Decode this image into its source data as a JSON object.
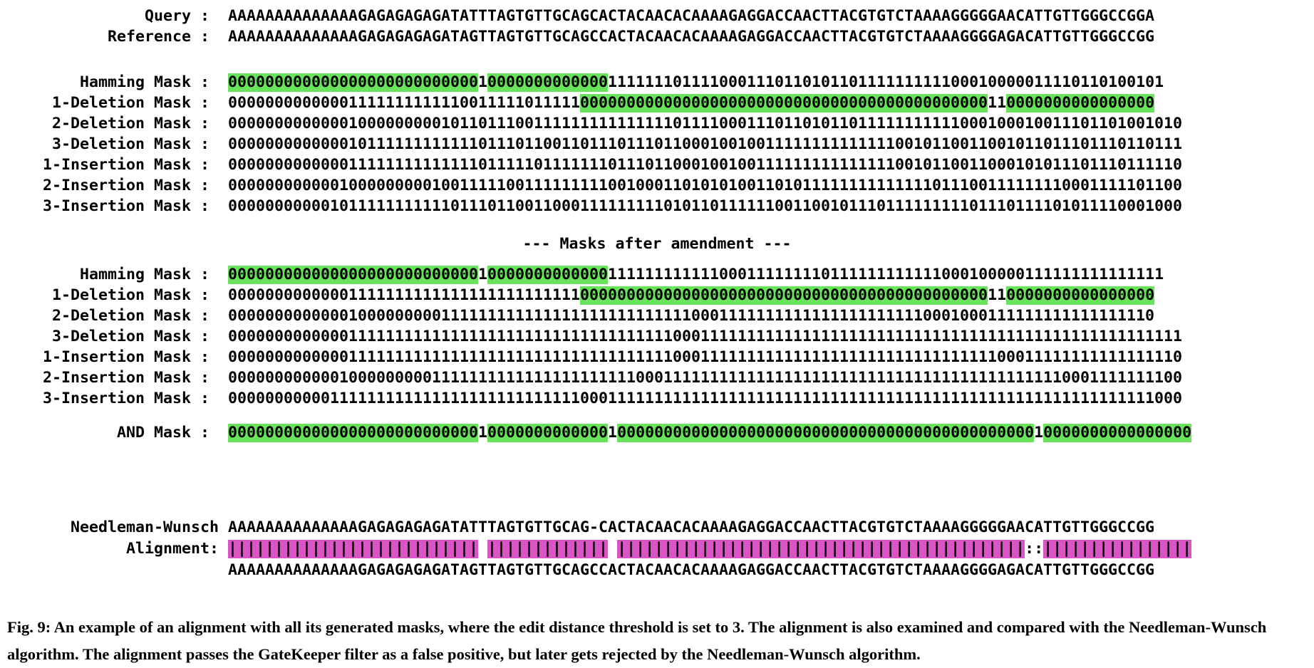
{
  "colors": {
    "match_highlight": "#6ae35c",
    "alignment_highlight": "#d955c4"
  },
  "sequences": [
    {
      "label": "Query",
      "separator": " : ",
      "segments": [
        {
          "text": "AAAAAAAAAAAAAAGAGAGAGAGATATTTAGTGTTGCAGCACTACAACACAAAAGAGGACCAACTTACGTGTCTAAAAGGGGGAACATTGTTGGGCCGGA",
          "hl": false
        }
      ]
    },
    {
      "label": "Reference",
      "separator": " : ",
      "segments": [
        {
          "text": "AAAAAAAAAAAAAAGAGAGAGAGATAGTTAGTGTTGCAGCCACTACAACACAAAAGAGGACCAACTTACGTGTCTAAAAGGGGAGACATTGTTGGGCCGG",
          "hl": false
        }
      ]
    }
  ],
  "masks_before": [
    {
      "label": "Hamming Mask",
      "separator": " : ",
      "segments": [
        {
          "text": "000000000000000000000000000",
          "hl": true
        },
        {
          "text": "1",
          "hl": false
        },
        {
          "text": "0000000000000",
          "hl": true
        },
        {
          "text": "111111101111000111011010110111111111100010000011110110100101",
          "hl": false
        }
      ]
    },
    {
      "label": "1-Deletion Mask",
      "separator": " : ",
      "segments": [
        {
          "text": "00000000000001111111111110011111011111",
          "hl": false
        },
        {
          "text": "00000000000000000000000000000000000000000000",
          "hl": true
        },
        {
          "text": "11",
          "hl": false
        },
        {
          "text": "0000000000000000",
          "hl": true
        }
      ]
    },
    {
      "label": "2-Deletion Mask",
      "separator": " : ",
      "segments": [
        {
          "text": "0000000000000100000000010110111001111111111111110111100011101101011011111111111000100010011101101001010",
          "hl": false
        }
      ]
    },
    {
      "label": "3-Deletion Mask",
      "separator": " : ",
      "segments": [
        {
          "text": "0000000000000101111111111110111011001101110111011000100100111111111111110010110011001011011101110110111",
          "hl": false
        }
      ]
    },
    {
      "label": "1-Insertion Mask",
      "separator": " : ",
      "segments": [
        {
          "text": "0000000000000111111111111110111110111111101110110001001001111111111111110010110011000101011101110111110",
          "hl": false
        }
      ]
    },
    {
      "label": "2-Insertion Mask",
      "separator": " : ",
      "segments": [
        {
          "text": "0000000000001000000000100111110011111111100100011010101001101011111111111111011100111111110001111101100",
          "hl": false
        }
      ]
    },
    {
      "label": "3-Insertion Mask",
      "separator": " : ",
      "segments": [
        {
          "text": "0000000000010111111111110111011001100011111111101011011111100110010111011111111101110111101011110001000",
          "hl": false
        }
      ]
    }
  ],
  "amend_title": "--- Masks after amendment ---",
  "masks_after": [
    {
      "label": "Hamming Mask",
      "separator": " : ",
      "segments": [
        {
          "text": "000000000000000000000000000",
          "hl": true
        },
        {
          "text": "1",
          "hl": false
        },
        {
          "text": "0000000000000",
          "hl": true
        },
        {
          "text": "111111111111000111111110111111111111000100000111111111111111",
          "hl": false
        }
      ]
    },
    {
      "label": "1-Deletion Mask",
      "separator": " : ",
      "segments": [
        {
          "text": "00000000000001111111111111111111111111",
          "hl": false
        },
        {
          "text": "00000000000000000000000000000000000000000000",
          "hl": true
        },
        {
          "text": "11",
          "hl": false
        },
        {
          "text": "0000000000000000",
          "hl": true
        }
      ]
    },
    {
      "label": "2-Deletion Mask",
      "separator": " : ",
      "segments": [
        {
          "text": "0000000000000100000000011111111111111111111111111100011111111111111111111110001000111111111111111110",
          "hl": false
        }
      ]
    },
    {
      "label": "3-Deletion Mask",
      "separator": " : ",
      "segments": [
        {
          "text": "0000000000000111111111111111111111111111111111110001111111111111111111111111111111111111111111111111111",
          "hl": false
        }
      ]
    },
    {
      "label": "1-Insertion Mask",
      "separator": " : ",
      "segments": [
        {
          "text": "0000000000000111111111111111111111111111111111110001111111111111111111111111111111100011111111111111110",
          "hl": false
        }
      ]
    },
    {
      "label": "2-Insertion Mask",
      "separator": " : ",
      "segments": [
        {
          "text": "0000000000001000000000111111111111111111111100011111111111111111111111111111111111111111110001111111100",
          "hl": false
        }
      ]
    },
    {
      "label": "3-Insertion Mask",
      "separator": " : ",
      "segments": [
        {
          "text": "0000000000011111111111111111111111111100011111111111111111111111111111111111111111111111111111111111000",
          "hl": false
        }
      ]
    }
  ],
  "and_mask": {
    "label": "AND Mask",
    "separator": " : ",
    "segments": [
      {
        "text": "000000000000000000000000000",
        "hl": true
      },
      {
        "text": "1",
        "hl": false
      },
      {
        "text": "0000000000000",
        "hl": true
      },
      {
        "text": "1",
        "hl": false
      },
      {
        "text": "000000000000000000000000000000000000000000000",
        "hl": true
      },
      {
        "text": "1",
        "hl": false
      },
      {
        "text": "0000000000000000",
        "hl": true
      }
    ]
  },
  "nw": {
    "label_line1": "Needleman-Wunsch",
    "label_line2": "Alignment:",
    "top": "AAAAAAAAAAAAAAGAGAGAGAGATATTTAGTGTTGCAG-CACTACAACACAAAAGAGGACCAACTTACGTGTCTAAAAGGGGGAACATTGTTGGGCCGG",
    "bottom": "AAAAAAAAAAAAAAGAGAGAGAGATAGTTAGTGTTGCAGCCACTACAACACAAAAGAGGACCAACTTACGTGTCTAAAAGGGGAGACATTGTTGGGCCGG",
    "bars": [
      {
        "text": "|||||||||||||||||||||||||||",
        "hl": true
      },
      {
        "text": " ",
        "hl": false
      },
      {
        "text": "|||||||||||||",
        "hl": true
      },
      {
        "text": " ",
        "hl": false
      },
      {
        "text": "||||||||||||||||||||||||||||||||||||||||||||",
        "hl": true
      },
      {
        "text": "::",
        "hl": false
      },
      {
        "text": "||||||||||||||||",
        "hl": true
      }
    ]
  },
  "caption": "Fig. 9: An example of an alignment with all its generated masks, where the edit distance threshold is set to 3. The alignment is also examined and compared with the Needleman-Wunsch algorithm. The alignment passes the GateKeeper filter as a false positive, but later gets rejected by the Needleman-Wunsch algorithm."
}
